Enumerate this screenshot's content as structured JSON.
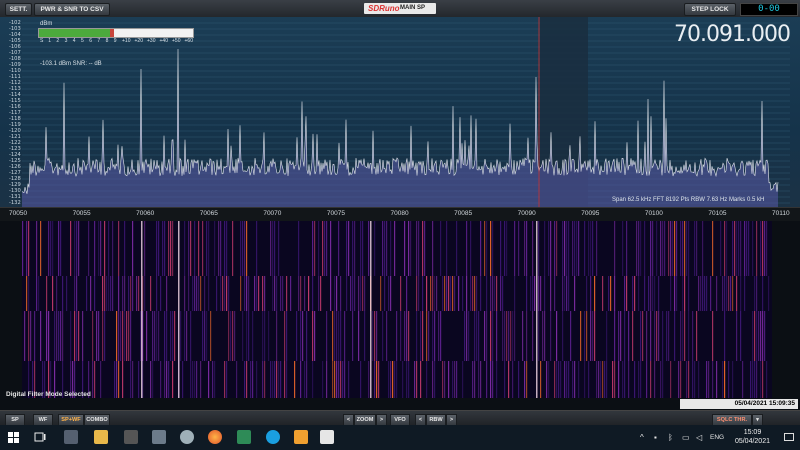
{
  "toolbar": {
    "sett_label": "SETT.",
    "csv_label": "PWR & SNR TO CSV",
    "logo_text": "SDRuno",
    "panel_title": "MAIN SP",
    "step_lock_label": "STEP LOCK",
    "clock": "0-00"
  },
  "spectrum": {
    "frequency_display": "70.091.000",
    "dbm_unit": "dBm",
    "reading": "-103.1 dBm  SNR: -- dB",
    "smeter_scale": [
      "S",
      "1",
      "2",
      "3",
      "4",
      "5",
      "6",
      "7",
      "8",
      "9",
      "+10",
      "+20",
      "+30",
      "+40",
      "+50",
      "+60"
    ],
    "smeter_level": 0.5,
    "y_labels": [
      "-102",
      "-103",
      "-104",
      "-105",
      "-106",
      "-107",
      "-108",
      "-109",
      "-110",
      "-111",
      "-112",
      "-113",
      "-114",
      "-115",
      "-116",
      "-117",
      "-118",
      "-119",
      "-120",
      "-121",
      "-122",
      "-123",
      "-124",
      "-125",
      "-126",
      "-127",
      "-128",
      "-129",
      "-130",
      "-131",
      "-132"
    ],
    "info": "Span 62.5 kHz   FFT 8192 Pts   RBW 7.63 Hz   Marks 0.5 kH"
  },
  "freq_axis": {
    "ticks": [
      "70050",
      "70055",
      "70060",
      "70065",
      "70070",
      "70075",
      "70080",
      "70085",
      "70090",
      "70095",
      "70100",
      "70105",
      "70110"
    ]
  },
  "waterfall": {
    "status": "Digital Filter Mode Selected",
    "datetime": "05/04/2021 15:09:35"
  },
  "bottom_bar": {
    "sp": "SP",
    "wf": "WF",
    "spwf": "SP+WF",
    "combo": "COMBO",
    "zoom_left": "<",
    "zoom": "ZOOM",
    "zoom_right": ">",
    "vfo": "VFO",
    "rbw_left": "<",
    "rbw": "RBW",
    "rbw_right": ">",
    "sqlc": "SQLC THR."
  },
  "taskbar": {
    "lang": "ENG",
    "time": "15:09",
    "date": "05/04/2021"
  },
  "colors": {
    "accent_orange": "#ffb24a",
    "spectrum_bg": "#1b3d55",
    "trace": "#e6e9ee",
    "marker": "#c83232"
  }
}
